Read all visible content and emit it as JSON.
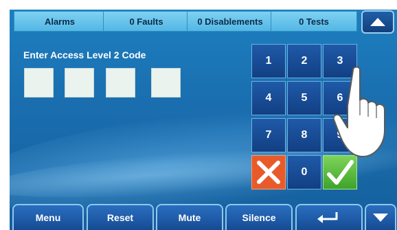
{
  "header": {
    "tabs": [
      {
        "label": "Alarms"
      },
      {
        "label": "0 Faults"
      },
      {
        "label": "0 Disablements"
      },
      {
        "label": "0 Tests"
      }
    ],
    "scroll_up_icon": "triangle-up-icon"
  },
  "entry": {
    "prompt": "Enter Access Level 2 Code",
    "code_boxes": 4
  },
  "keypad": {
    "keys": [
      "1",
      "2",
      "3",
      "4",
      "5",
      "6",
      "7",
      "8",
      "9",
      "0"
    ],
    "cancel_icon": "x-icon",
    "ok_icon": "checkmark-icon",
    "colors": {
      "cancel": "#e95a2a",
      "ok": "#5cc23e",
      "key": "#1a4c95"
    }
  },
  "footer": {
    "buttons": [
      {
        "label": "Menu"
      },
      {
        "label": "Reset"
      },
      {
        "label": "Mute"
      },
      {
        "label": "Silence"
      }
    ],
    "return_icon": "return-arrow-icon",
    "scroll_down_icon": "triangle-down-icon"
  },
  "overlay": {
    "hand_icon": "pointing-hand-icon"
  }
}
